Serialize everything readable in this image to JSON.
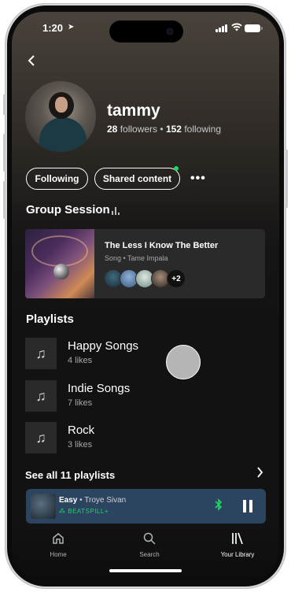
{
  "status_bar": {
    "time": "1:20",
    "location_glyph": "➤"
  },
  "profile": {
    "name": "tammy",
    "followers_count": "28",
    "followers_label": "followers",
    "separator": "•",
    "following_count": "152",
    "following_label": "following"
  },
  "actions": {
    "following_label": "Following",
    "shared_label": "Shared content",
    "more_label": "•••"
  },
  "group_session": {
    "heading": "Group Session",
    "track_title": "The Less I Know The Better",
    "track_meta": "Song • Tame Impala",
    "extra_participants": "+2"
  },
  "playlists": {
    "heading": "Playlists",
    "items": [
      {
        "name": "Happy Songs",
        "likes": "4 likes"
      },
      {
        "name": "Indie Songs",
        "likes": "7 likes"
      },
      {
        "name": "Rock",
        "likes": "3 likes"
      }
    ],
    "see_all": "See all 11 playlists"
  },
  "now_playing": {
    "title": "Easy",
    "separator": " • ",
    "artist": "Troye Sivan",
    "device": "BEATSPILL+"
  },
  "nav": {
    "home": "Home",
    "search": "Search",
    "library": "Your Library"
  },
  "colors": {
    "accent_green": "#1ed760",
    "mini_player_bg": "#2b4460"
  }
}
